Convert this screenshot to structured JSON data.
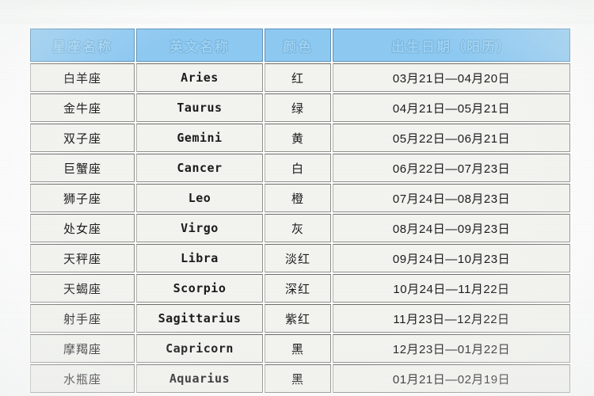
{
  "page": {
    "top_faint_text": "· · · · ·   · ·   · · ·"
  },
  "table": {
    "headers": {
      "name": "星座名称",
      "english": "英文名称",
      "color": "颜色",
      "birthdate": "出生日期（阳历）"
    },
    "colors": {
      "header_bg": "#8ec9f2",
      "header_text": "#9fd2f3",
      "cell_bg": "#f3f3ef",
      "cell_border": "#8f8f8a",
      "page_bg": "#fdfdfd"
    },
    "rows": [
      {
        "name": "白羊座",
        "english": "Aries",
        "color": "红",
        "birthdate": "03月21日—04月20日"
      },
      {
        "name": "金牛座",
        "english": "Taurus",
        "color": "绿",
        "birthdate": "04月21日—05月21日"
      },
      {
        "name": "双子座",
        "english": "Gemini",
        "color": "黄",
        "birthdate": "05月22日—06月21日"
      },
      {
        "name": "巨蟹座",
        "english": "Cancer",
        "color": "白",
        "birthdate": "06月22日—07月23日"
      },
      {
        "name": "狮子座",
        "english": "Leo",
        "color": "橙",
        "birthdate": "07月24日—08月23日"
      },
      {
        "name": "处女座",
        "english": "Virgo",
        "color": "灰",
        "birthdate": "08月24日—09月23日"
      },
      {
        "name": "天秤座",
        "english": "Libra",
        "color": "淡红",
        "birthdate": "09月24日—10月23日"
      },
      {
        "name": "天蝎座",
        "english": "Scorpio",
        "color": "深红",
        "birthdate": "10月24日—11月22日"
      },
      {
        "name": "射手座",
        "english": "Sagittarius",
        "color": "紫红",
        "birthdate": "11月23日—12月22日"
      },
      {
        "name": "摩羯座",
        "english": "Capricorn",
        "color": "黑",
        "birthdate": "12月23日—01月22日"
      },
      {
        "name": "水瓶座",
        "english": "Aquarius",
        "color": "黑",
        "birthdate": "01月21日—02月19日"
      }
    ]
  }
}
